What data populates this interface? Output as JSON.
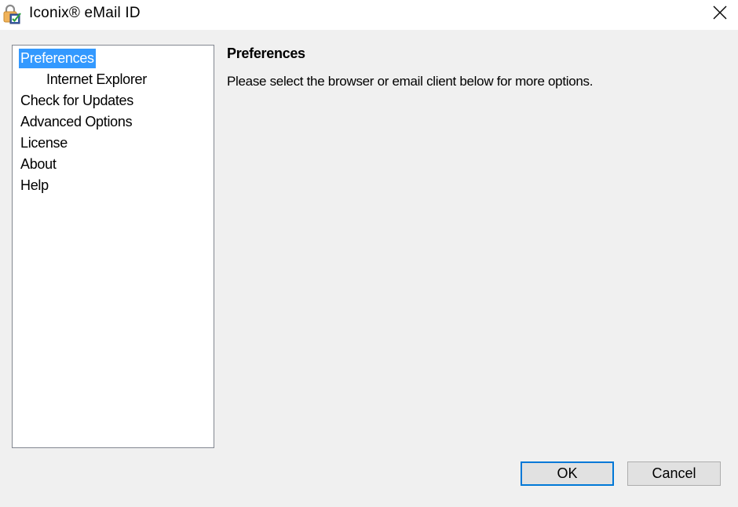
{
  "window": {
    "title": "Iconix® eMail ID",
    "icon": "lock-check-icon",
    "close_icon": "close-icon"
  },
  "tree": {
    "items": [
      {
        "label": "Preferences",
        "level": 0,
        "selected": true
      },
      {
        "label": "Internet Explorer",
        "level": 1,
        "selected": false
      },
      {
        "label": "Check for Updates",
        "level": 0,
        "selected": false
      },
      {
        "label": "Advanced Options",
        "level": 0,
        "selected": false
      },
      {
        "label": "License",
        "level": 0,
        "selected": false
      },
      {
        "label": "About",
        "level": 0,
        "selected": false
      },
      {
        "label": "Help",
        "level": 0,
        "selected": false
      }
    ]
  },
  "content": {
    "heading": "Preferences",
    "description": "Please select the browser or email client below for more options."
  },
  "buttons": {
    "ok": "OK",
    "cancel": "Cancel"
  },
  "colors": {
    "selection": "#3399ff",
    "default_button_border": "#0078d7"
  }
}
